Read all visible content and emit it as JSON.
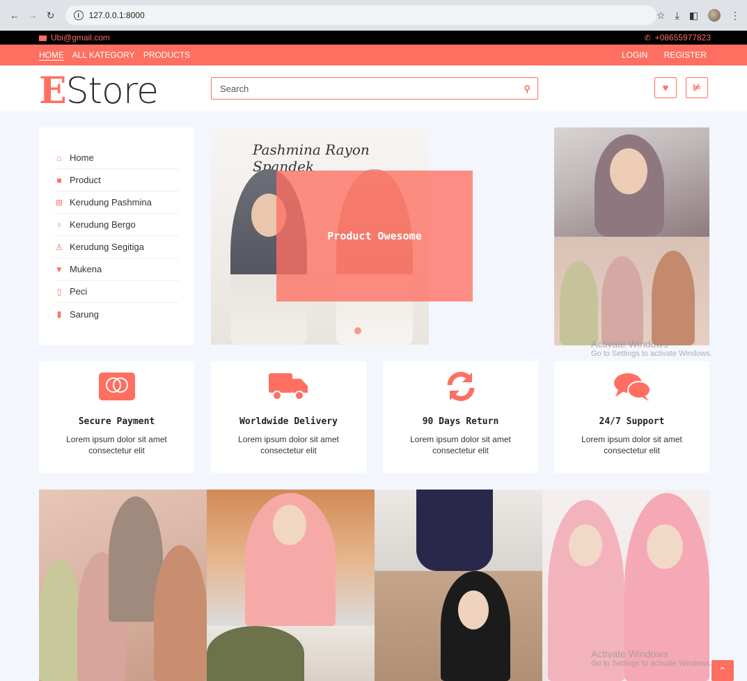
{
  "browser": {
    "url": "127.0.0.1:8000",
    "back_icon": "arrow-left-icon",
    "forward_icon": "arrow-right-icon",
    "reload_icon": "reload-icon"
  },
  "topbar": {
    "email": "Ubi@gmail.com",
    "phone": "+08655977823"
  },
  "nav": {
    "home": "HOME",
    "kategory": "ALL KATEGORY",
    "products": "PRODUCTS",
    "login": "LOGIN",
    "register": "REGISTER"
  },
  "header": {
    "logo_e": "E",
    "logo_rest": "Store",
    "search_placeholder": "Search"
  },
  "sidebar": {
    "items": [
      {
        "label": "Home",
        "icon": "home-icon"
      },
      {
        "label": "Product",
        "icon": "bag-icon"
      },
      {
        "label": "Kerudung Pashmina",
        "icon": "plus-square-icon"
      },
      {
        "label": "Kerudung Bergo",
        "icon": "female-icon"
      },
      {
        "label": "Kerudung Segitiga",
        "icon": "child-icon"
      },
      {
        "label": "Mukena",
        "icon": "shirt-icon"
      },
      {
        "label": "Peci",
        "icon": "tablet-icon"
      },
      {
        "label": "Sarung",
        "icon": "bookmark-icon"
      }
    ]
  },
  "carousel": {
    "script_text": "Pashmina Rayon Spandek",
    "overlay_text": "Product Owesome"
  },
  "features": [
    {
      "title": "Secure Payment",
      "desc": "Lorem ipsum dolor sit amet consectetur elit",
      "icon": "credit-card-icon"
    },
    {
      "title": "Worldwide Delivery",
      "desc": "Lorem ipsum dolor sit amet consectetur elit",
      "icon": "truck-icon"
    },
    {
      "title": "90 Days Return",
      "desc": "Lorem ipsum dolor sit amet consectetur elit",
      "icon": "sync-icon"
    },
    {
      "title": "24/7 Support",
      "desc": "Lorem ipsum dolor sit amet consectetur elit",
      "icon": "comments-icon"
    }
  ],
  "watermark": {
    "title": "Activate Windows",
    "subtitle": "Go to Settings to activate Windows."
  },
  "colors": {
    "accent": "#ff6f61",
    "topbar_bg": "#000000",
    "page_bg": "#f4f6fe"
  }
}
